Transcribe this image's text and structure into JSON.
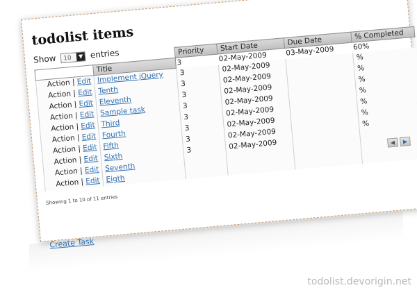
{
  "page": {
    "title": "todolist items",
    "show_label": "Show",
    "entries_label": "entries",
    "page_size": "10",
    "info": "Showing 1 to 10 of 11 entries",
    "create_link": "Create Task",
    "watermark": "todolist.devorigin.net"
  },
  "table": {
    "columns": {
      "title": "Title",
      "priority": "Priority",
      "start_date": "Start Date",
      "due_date": "Due Date",
      "completed": "% Completed"
    },
    "first_row": {
      "due_date": "03-May-2009",
      "completed": "60%"
    },
    "rows": [
      {
        "action": "Action",
        "edit": "Edit",
        "title": "Implement jQuery",
        "priority": "3",
        "start": "02-May-2009",
        "pct": "%"
      },
      {
        "action": "Action",
        "edit": "Edit",
        "title": "Tenth",
        "priority": "3",
        "start": "02-May-2009",
        "pct": "%"
      },
      {
        "action": "Action",
        "edit": "Edit",
        "title": "Eleventh",
        "priority": "3",
        "start": "02-May-2009",
        "pct": "%"
      },
      {
        "action": "Action",
        "edit": "Edit",
        "title": "Sample task",
        "priority": "3",
        "start": "02-May-2009",
        "pct": "%"
      },
      {
        "action": "Action",
        "edit": "Edit",
        "title": "Third",
        "priority": "3",
        "start": "02-May-2009",
        "pct": "%"
      },
      {
        "action": "Action",
        "edit": "Edit",
        "title": "Fourth",
        "priority": "3",
        "start": "02-May-2009",
        "pct": "%"
      },
      {
        "action": "Action",
        "edit": "Edit",
        "title": "Fifth",
        "priority": "3",
        "start": "02-May-2009",
        "pct": "%"
      },
      {
        "action": "Action",
        "edit": "Edit",
        "title": "Sixth",
        "priority": "3",
        "start": "02-May-2009",
        "pct": ""
      },
      {
        "action": "Action",
        "edit": "Edit",
        "title": "Seventh",
        "priority": "3",
        "start": "02-May-2009",
        "pct": ""
      },
      {
        "action": "Action",
        "edit": "Edit",
        "title": "Eigth",
        "priority": "",
        "start": "",
        "pct": ""
      }
    ]
  },
  "icons": {
    "prev": "chevron-left-icon",
    "next": "chevron-right-icon",
    "dropdown": "chevron-down-icon"
  },
  "colors": {
    "link": "#2e6fb0",
    "header_bg": "#c8c8c8",
    "border_dashed": "#c79a6a"
  }
}
